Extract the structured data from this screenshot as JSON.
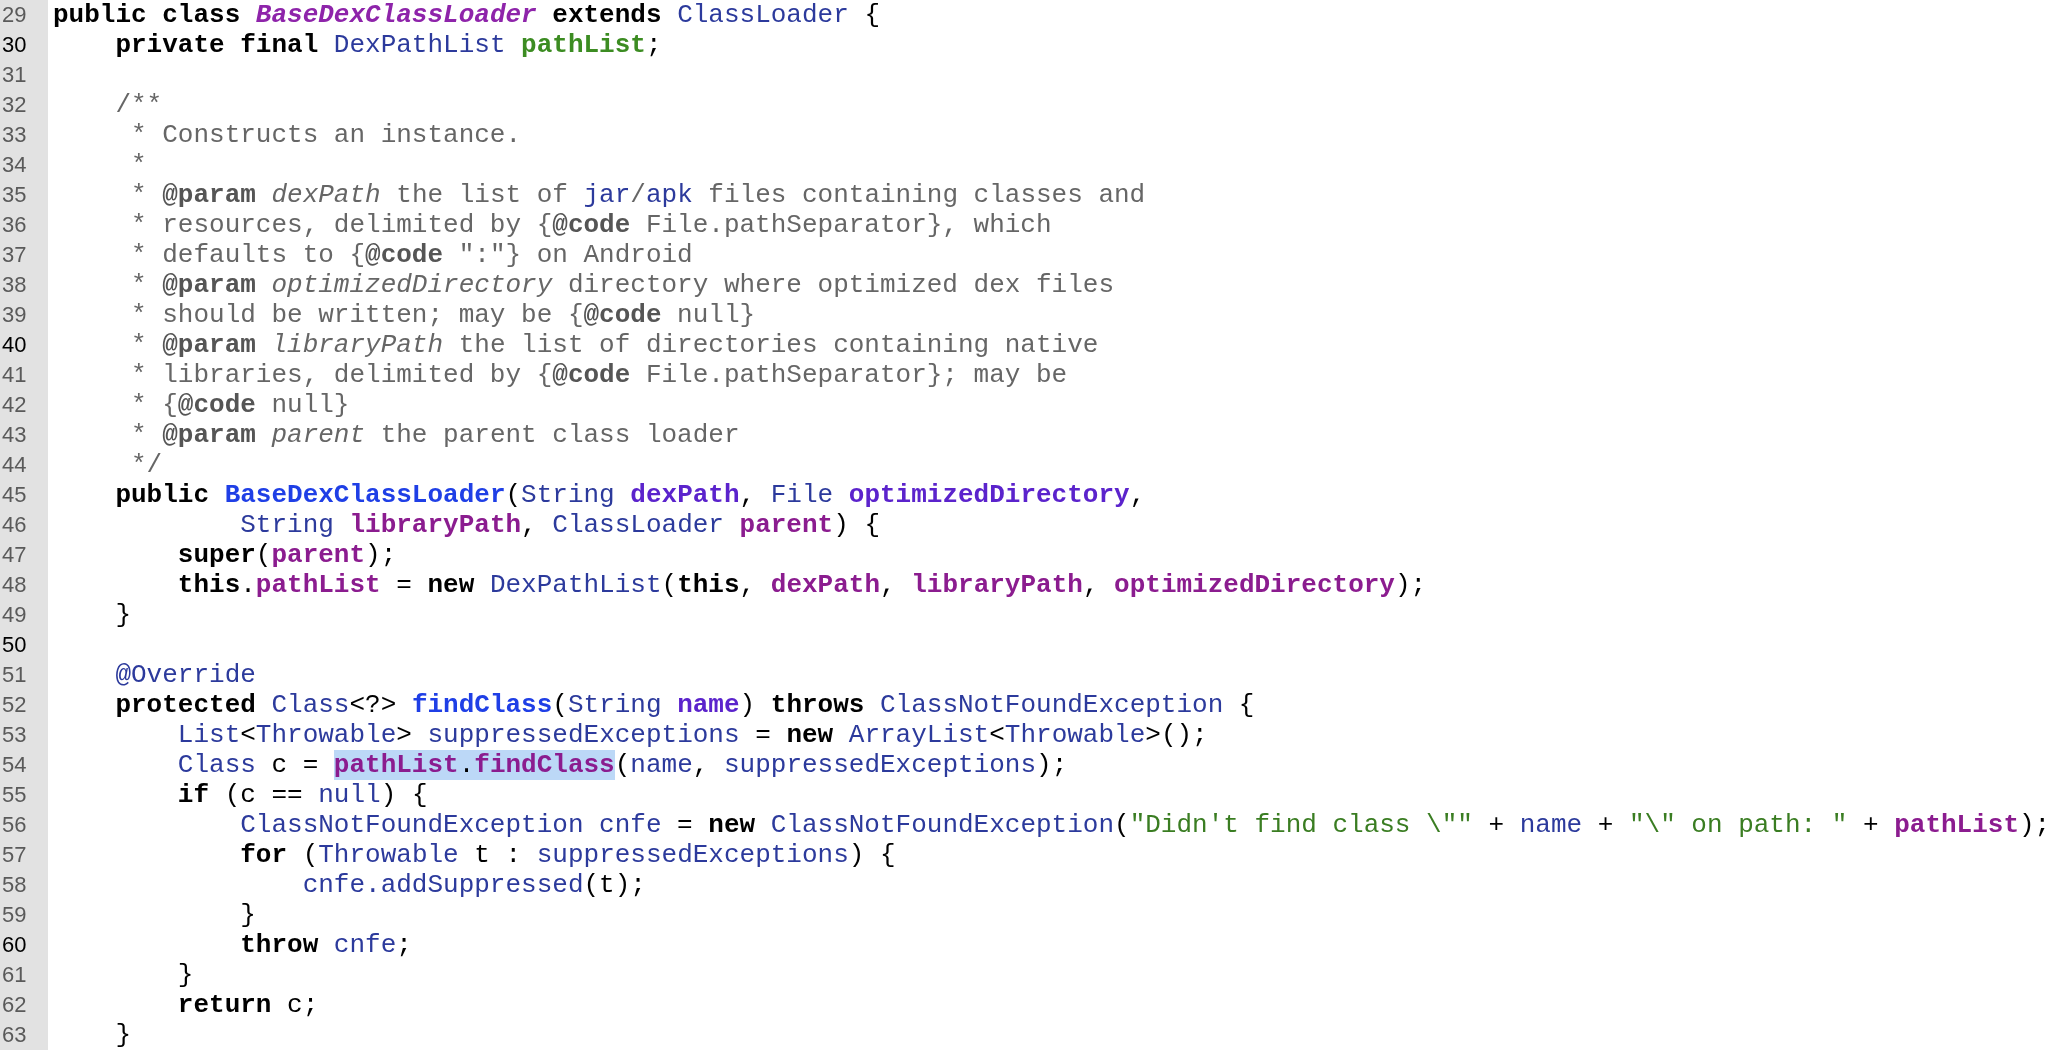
{
  "editor": {
    "lines": [
      {
        "number": "29",
        "emphasized": false,
        "tokens": [
          {
            "text": "public class ",
            "kind": "keyword"
          },
          {
            "text": "BaseDexClassLoader",
            "kind": "class-name"
          },
          {
            "text": " extends ",
            "kind": "keyword"
          },
          {
            "text": "ClassLoader",
            "kind": "type"
          },
          {
            "text": " {",
            "kind": "plain"
          }
        ]
      },
      {
        "number": "30",
        "emphasized": true,
        "tokens": [
          {
            "text": "    private final ",
            "kind": "keyword"
          },
          {
            "text": "DexPathList ",
            "kind": "type"
          },
          {
            "text": "pathList",
            "kind": "field-decl"
          },
          {
            "text": ";",
            "kind": "plain"
          }
        ]
      },
      {
        "number": "31",
        "emphasized": false
      },
      {
        "number": "32",
        "emphasized": false,
        "tokens": [
          {
            "text": "    /**",
            "kind": "comment"
          }
        ]
      },
      {
        "number": "33",
        "emphasized": false,
        "tokens": [
          {
            "text": "     * Constructs an instance.",
            "kind": "comment"
          }
        ]
      },
      {
        "number": "34",
        "emphasized": false,
        "tokens": [
          {
            "text": "     *",
            "kind": "comment"
          }
        ]
      },
      {
        "number": "35",
        "emphasized": false,
        "tokens": [
          {
            "text": "     * ",
            "kind": "comment"
          },
          {
            "text": "@param",
            "kind": "comment-tag"
          },
          {
            "text": " dexPath",
            "kind": "comment-name"
          },
          {
            "text": " the list of ",
            "kind": "comment"
          },
          {
            "text": "jar",
            "kind": "comment-link"
          },
          {
            "text": "/",
            "kind": "comment"
          },
          {
            "text": "apk",
            "kind": "comment-link"
          },
          {
            "text": " files containing classes and",
            "kind": "comment"
          }
        ]
      },
      {
        "number": "36",
        "emphasized": false,
        "tokens": [
          {
            "text": "     * resources, delimited by {",
            "kind": "comment"
          },
          {
            "text": "@code",
            "kind": "comment-tag"
          },
          {
            "text": " File.pathSeparator}, which",
            "kind": "comment"
          }
        ]
      },
      {
        "number": "37",
        "emphasized": false,
        "tokens": [
          {
            "text": "     * defaults to {",
            "kind": "comment"
          },
          {
            "text": "@code",
            "kind": "comment-tag"
          },
          {
            "text": " \":\"} on Android",
            "kind": "comment"
          }
        ]
      },
      {
        "number": "38",
        "emphasized": false,
        "tokens": [
          {
            "text": "     * ",
            "kind": "comment"
          },
          {
            "text": "@param",
            "kind": "comment-tag"
          },
          {
            "text": " optimizedDirectory",
            "kind": "comment-name"
          },
          {
            "text": " directory where optimized dex files",
            "kind": "comment"
          }
        ]
      },
      {
        "number": "39",
        "emphasized": false,
        "tokens": [
          {
            "text": "     * should be written; may be {",
            "kind": "comment"
          },
          {
            "text": "@code",
            "kind": "comment-tag"
          },
          {
            "text": " null}",
            "kind": "comment"
          }
        ]
      },
      {
        "number": "40",
        "emphasized": true,
        "tokens": [
          {
            "text": "     * ",
            "kind": "comment"
          },
          {
            "text": "@param",
            "kind": "comment-tag"
          },
          {
            "text": " libraryPath",
            "kind": "comment-name"
          },
          {
            "text": " the list of directories containing native",
            "kind": "comment"
          }
        ]
      },
      {
        "number": "41",
        "emphasized": false,
        "tokens": [
          {
            "text": "     * libraries, delimited by {",
            "kind": "comment"
          },
          {
            "text": "@code",
            "kind": "comment-tag"
          },
          {
            "text": " File.pathSeparator}; may be",
            "kind": "comment"
          }
        ]
      },
      {
        "number": "42",
        "emphasized": false,
        "tokens": [
          {
            "text": "     * {",
            "kind": "comment"
          },
          {
            "text": "@code",
            "kind": "comment-tag"
          },
          {
            "text": " null}",
            "kind": "comment"
          }
        ]
      },
      {
        "number": "43",
        "emphasized": false,
        "tokens": [
          {
            "text": "     * ",
            "kind": "comment"
          },
          {
            "text": "@param",
            "kind": "comment-tag"
          },
          {
            "text": " parent",
            "kind": "comment-name"
          },
          {
            "text": " the parent class loader",
            "kind": "comment"
          }
        ]
      },
      {
        "number": "44",
        "emphasized": false,
        "tokens": [
          {
            "text": "     */",
            "kind": "comment"
          }
        ]
      },
      {
        "number": "45",
        "emphasized": false,
        "tokens": [
          {
            "text": "    public ",
            "kind": "keyword"
          },
          {
            "text": "BaseDexClassLoader",
            "kind": "method"
          },
          {
            "text": "(",
            "kind": "plain"
          },
          {
            "text": "String ",
            "kind": "type"
          },
          {
            "text": "dexPath",
            "kind": "param-decl"
          },
          {
            "text": ", ",
            "kind": "plain"
          },
          {
            "text": "File ",
            "kind": "type"
          },
          {
            "text": "optimizedDirectory",
            "kind": "param-decl"
          },
          {
            "text": ",",
            "kind": "plain"
          }
        ]
      },
      {
        "number": "46",
        "emphasized": false,
        "tokens": [
          {
            "text": "            String ",
            "kind": "type"
          },
          {
            "text": "libraryPath",
            "kind": "param"
          },
          {
            "text": ", ",
            "kind": "plain"
          },
          {
            "text": "ClassLoader ",
            "kind": "type"
          },
          {
            "text": "parent",
            "kind": "param"
          },
          {
            "text": ") {",
            "kind": "plain"
          }
        ]
      },
      {
        "number": "47",
        "emphasized": false,
        "tokens": [
          {
            "text": "        super",
            "kind": "keyword"
          },
          {
            "text": "(",
            "kind": "plain"
          },
          {
            "text": "parent",
            "kind": "param"
          },
          {
            "text": ");",
            "kind": "plain"
          }
        ]
      },
      {
        "number": "48",
        "emphasized": false,
        "tokens": [
          {
            "text": "        this",
            "kind": "keyword"
          },
          {
            "text": ".",
            "kind": "plain"
          },
          {
            "text": "pathList",
            "kind": "param"
          },
          {
            "text": " = ",
            "kind": "plain"
          },
          {
            "text": "new ",
            "kind": "keyword"
          },
          {
            "text": "DexPathList",
            "kind": "type"
          },
          {
            "text": "(",
            "kind": "plain"
          },
          {
            "text": "this",
            "kind": "keyword"
          },
          {
            "text": ", ",
            "kind": "plain"
          },
          {
            "text": "dexPath",
            "kind": "param"
          },
          {
            "text": ", ",
            "kind": "plain"
          },
          {
            "text": "libraryPath",
            "kind": "param"
          },
          {
            "text": ", ",
            "kind": "plain"
          },
          {
            "text": "optimizedDirectory",
            "kind": "param"
          },
          {
            "text": ");",
            "kind": "plain"
          }
        ]
      },
      {
        "number": "49",
        "emphasized": false,
        "tokens": [
          {
            "text": "    }",
            "kind": "plain"
          }
        ]
      },
      {
        "number": "50",
        "emphasized": true
      },
      {
        "number": "51",
        "emphasized": false,
        "tokens": [
          {
            "text": "    @Override",
            "kind": "type"
          }
        ]
      },
      {
        "number": "52",
        "emphasized": false,
        "tokens": [
          {
            "text": "    protected ",
            "kind": "keyword"
          },
          {
            "text": "Class",
            "kind": "type"
          },
          {
            "text": "<?> ",
            "kind": "plain"
          },
          {
            "text": "findClass",
            "kind": "method"
          },
          {
            "text": "(",
            "kind": "plain"
          },
          {
            "text": "String ",
            "kind": "type"
          },
          {
            "text": "name",
            "kind": "param-decl"
          },
          {
            "text": ") ",
            "kind": "plain"
          },
          {
            "text": "throws ",
            "kind": "keyword"
          },
          {
            "text": "ClassNotFoundException",
            "kind": "type"
          },
          {
            "text": " {",
            "kind": "plain"
          }
        ]
      },
      {
        "number": "53",
        "emphasized": false,
        "tokens": [
          {
            "text": "        List",
            "kind": "type"
          },
          {
            "text": "<",
            "kind": "plain"
          },
          {
            "text": "Throwable",
            "kind": "type"
          },
          {
            "text": "> ",
            "kind": "plain"
          },
          {
            "text": "suppressedExceptions",
            "kind": "local"
          },
          {
            "text": " = ",
            "kind": "plain"
          },
          {
            "text": "new ",
            "kind": "keyword"
          },
          {
            "text": "ArrayList",
            "kind": "type"
          },
          {
            "text": "<",
            "kind": "plain"
          },
          {
            "text": "Throwable",
            "kind": "type"
          },
          {
            "text": ">();",
            "kind": "plain"
          }
        ]
      },
      {
        "number": "54",
        "emphasized": false,
        "tokens": [
          {
            "text": "        Class",
            "kind": "type",
            "selected": false
          },
          {
            "text": " c = ",
            "kind": "plain",
            "selected": false
          },
          {
            "text": "pathList",
            "kind": "param",
            "selected": true
          },
          {
            "text": ".",
            "kind": "plain",
            "selected": true
          },
          {
            "text": "findClass",
            "kind": "param",
            "selected": true
          },
          {
            "text": "(",
            "kind": "plain",
            "selected": false
          },
          {
            "text": "name",
            "kind": "local",
            "selected": false
          },
          {
            "text": ", ",
            "kind": "plain",
            "selected": false
          },
          {
            "text": "suppressedExceptions",
            "kind": "local",
            "selected": false
          },
          {
            "text": ");",
            "kind": "plain",
            "selected": false
          }
        ]
      },
      {
        "number": "55",
        "emphasized": false,
        "tokens": [
          {
            "text": "        if",
            "kind": "keyword"
          },
          {
            "text": " (c == ",
            "kind": "plain"
          },
          {
            "text": "null",
            "kind": "local"
          },
          {
            "text": ") {",
            "kind": "plain"
          }
        ]
      },
      {
        "number": "56",
        "emphasized": false,
        "tokens": [
          {
            "text": "            ClassNotFoundException ",
            "kind": "type"
          },
          {
            "text": "cnfe",
            "kind": "local"
          },
          {
            "text": " = ",
            "kind": "plain"
          },
          {
            "text": "new ",
            "kind": "keyword"
          },
          {
            "text": "ClassNotFoundException",
            "kind": "type"
          },
          {
            "text": "(",
            "kind": "plain"
          },
          {
            "text": "\"Didn't find class \\\"\"",
            "kind": "string"
          },
          {
            "text": " + ",
            "kind": "plain"
          },
          {
            "text": "name",
            "kind": "local"
          },
          {
            "text": " + ",
            "kind": "plain"
          },
          {
            "text": "\"\\\" on path: \"",
            "kind": "string"
          },
          {
            "text": " + ",
            "kind": "plain"
          },
          {
            "text": "pathList",
            "kind": "param"
          },
          {
            "text": ");",
            "kind": "plain"
          }
        ]
      },
      {
        "number": "57",
        "emphasized": false,
        "tokens": [
          {
            "text": "            for",
            "kind": "keyword"
          },
          {
            "text": " (",
            "kind": "plain"
          },
          {
            "text": "Throwable",
            "kind": "type"
          },
          {
            "text": " t : ",
            "kind": "plain"
          },
          {
            "text": "suppressedExceptions",
            "kind": "local"
          },
          {
            "text": ") {",
            "kind": "plain"
          }
        ]
      },
      {
        "number": "58",
        "emphasized": false,
        "tokens": [
          {
            "text": "                cnfe.addSuppressed",
            "kind": "local"
          },
          {
            "text": "(t);",
            "kind": "plain"
          }
        ]
      },
      {
        "number": "59",
        "emphasized": false,
        "tokens": [
          {
            "text": "            }",
            "kind": "plain"
          }
        ]
      },
      {
        "number": "60",
        "emphasized": true,
        "tokens": [
          {
            "text": "            throw ",
            "kind": "keyword"
          },
          {
            "text": "cnfe",
            "kind": "local"
          },
          {
            "text": ";",
            "kind": "plain"
          }
        ]
      },
      {
        "number": "61",
        "emphasized": false,
        "tokens": [
          {
            "text": "        }",
            "kind": "plain"
          }
        ]
      },
      {
        "number": "62",
        "emphasized": false,
        "tokens": [
          {
            "text": "        return",
            "kind": "keyword"
          },
          {
            "text": " c;",
            "kind": "plain"
          }
        ]
      },
      {
        "number": "63",
        "emphasized": false,
        "tokens": [
          {
            "text": "    }",
            "kind": "plain"
          }
        ]
      }
    ]
  }
}
